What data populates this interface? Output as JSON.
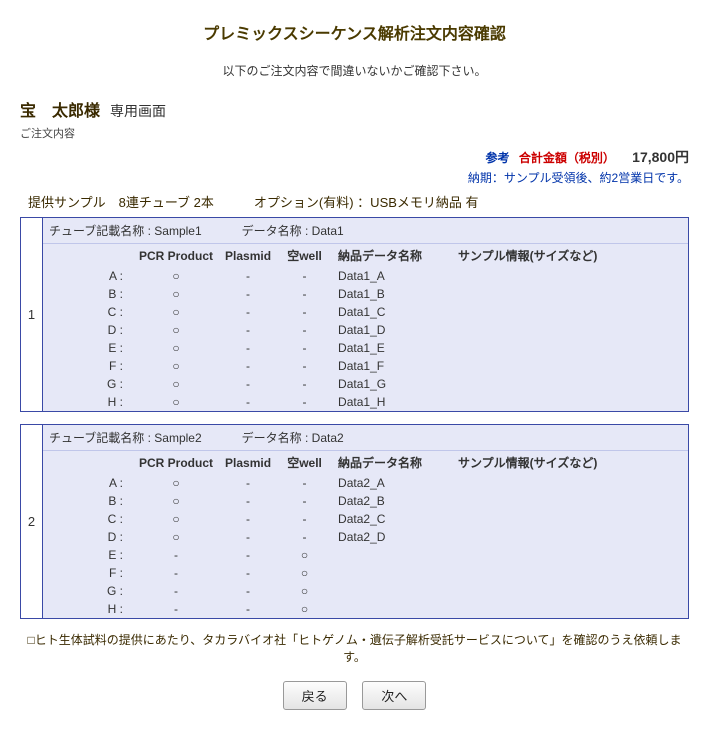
{
  "title": "プレミックスシーケンス解析注文内容確認",
  "lead": "以下のご注文内容で間違いないかご確認下さい。",
  "user": {
    "name": "宝　太郎様",
    "screen": "専用画面"
  },
  "order_label": "ご注文内容",
  "price": {
    "ref": "参考",
    "total_label": "合計金額（税別）",
    "total_value": "17,800円",
    "delivery": "納期：サンプル受領後、約2営業日です。"
  },
  "samples_row": {
    "sample": "提供サンプル　8連チューブ 2本",
    "option": "オプション(有料) ：USBメモリ納品 有"
  },
  "columns": {
    "pcr": "PCR Product",
    "plasmid": "Plasmid",
    "empty": "空well",
    "dataname": "納品データ名称",
    "info": "サンプル情報(サイズなど)"
  },
  "tubes": [
    {
      "idx": "1",
      "tube_label": "チューブ記載名称 : Sample1",
      "data_label": "データ名称 : Data1",
      "rows": [
        {
          "well": "A :",
          "pcr": "○",
          "plasmid": "-",
          "empty": "-",
          "dname": "Data1_A",
          "info": ""
        },
        {
          "well": "B :",
          "pcr": "○",
          "plasmid": "-",
          "empty": "-",
          "dname": "Data1_B",
          "info": ""
        },
        {
          "well": "C :",
          "pcr": "○",
          "plasmid": "-",
          "empty": "-",
          "dname": "Data1_C",
          "info": ""
        },
        {
          "well": "D :",
          "pcr": "○",
          "plasmid": "-",
          "empty": "-",
          "dname": "Data1_D",
          "info": ""
        },
        {
          "well": "E :",
          "pcr": "○",
          "plasmid": "-",
          "empty": "-",
          "dname": "Data1_E",
          "info": ""
        },
        {
          "well": "F :",
          "pcr": "○",
          "plasmid": "-",
          "empty": "-",
          "dname": "Data1_F",
          "info": ""
        },
        {
          "well": "G :",
          "pcr": "○",
          "plasmid": "-",
          "empty": "-",
          "dname": "Data1_G",
          "info": ""
        },
        {
          "well": "H :",
          "pcr": "○",
          "plasmid": "-",
          "empty": "-",
          "dname": "Data1_H",
          "info": ""
        }
      ]
    },
    {
      "idx": "2",
      "tube_label": "チューブ記載名称 : Sample2",
      "data_label": "データ名称 : Data2",
      "rows": [
        {
          "well": "A :",
          "pcr": "○",
          "plasmid": "-",
          "empty": "-",
          "dname": "Data2_A",
          "info": ""
        },
        {
          "well": "B :",
          "pcr": "○",
          "plasmid": "-",
          "empty": "-",
          "dname": "Data2_B",
          "info": ""
        },
        {
          "well": "C :",
          "pcr": "○",
          "plasmid": "-",
          "empty": "-",
          "dname": "Data2_C",
          "info": ""
        },
        {
          "well": "D :",
          "pcr": "○",
          "plasmid": "-",
          "empty": "-",
          "dname": "Data2_D",
          "info": ""
        },
        {
          "well": "E :",
          "pcr": "-",
          "plasmid": "-",
          "empty": "○",
          "dname": "",
          "info": ""
        },
        {
          "well": "F :",
          "pcr": "-",
          "plasmid": "-",
          "empty": "○",
          "dname": "",
          "info": ""
        },
        {
          "well": "G :",
          "pcr": "-",
          "plasmid": "-",
          "empty": "○",
          "dname": "",
          "info": ""
        },
        {
          "well": "H :",
          "pcr": "-",
          "plasmid": "-",
          "empty": "○",
          "dname": "",
          "info": ""
        }
      ]
    }
  ],
  "footnote": "□ヒト生体試料の提供にあたり、タカラバイオ社「ヒトゲノム・遺伝子解析受託サービスについて」を確認のうえ依頼します。",
  "buttons": {
    "back": "戻る",
    "next": "次へ"
  }
}
